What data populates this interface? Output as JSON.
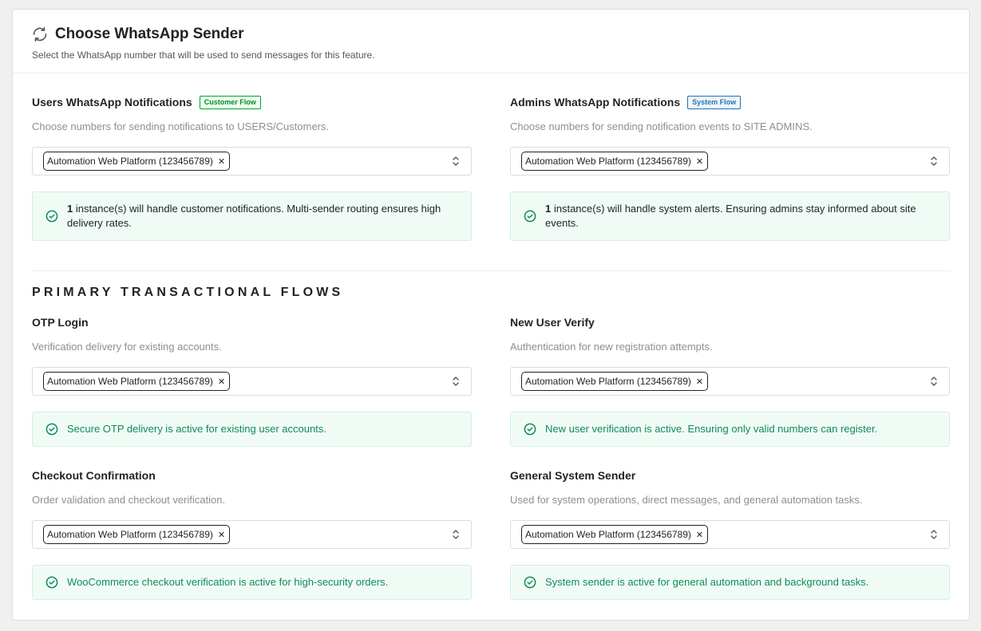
{
  "header": {
    "title": "Choose WhatsApp Sender",
    "subtitle": "Select the WhatsApp number that will be used to send messages for this feature."
  },
  "users_notifications": {
    "title": "Users WhatsApp Notifications",
    "badge": "Customer Flow",
    "description": "Choose numbers for sending notifications to USERS/Customers.",
    "selected": "Automation Web Platform (123456789)",
    "notice_count": "1",
    "notice_text": " instance(s) will handle customer notifications. Multi-sender routing ensures high delivery rates."
  },
  "admins_notifications": {
    "title": "Admins WhatsApp Notifications",
    "badge": "System Flow",
    "description": "Choose numbers for sending notification events to SITE ADMINS.",
    "selected": "Automation Web Platform (123456789)",
    "notice_count": "1",
    "notice_text": " instance(s) will handle system alerts. Ensuring admins stay informed about site events."
  },
  "section_heading": "PRIMARY TRANSACTIONAL FLOWS",
  "otp_login": {
    "title": "OTP Login",
    "description": "Verification delivery for existing accounts.",
    "selected": "Automation Web Platform (123456789)",
    "notice": "Secure OTP delivery is active for existing user accounts."
  },
  "new_user_verify": {
    "title": "New User Verify",
    "description": "Authentication for new registration attempts.",
    "selected": "Automation Web Platform (123456789)",
    "notice": "New user verification is active. Ensuring only valid numbers can register."
  },
  "checkout_confirmation": {
    "title": "Checkout Confirmation",
    "description": "Order validation and checkout verification.",
    "selected": "Automation Web Platform (123456789)",
    "notice": "WooCommerce checkout verification is active for high-security orders."
  },
  "general_system_sender": {
    "title": "General System Sender",
    "description": "Used for system operations, direct messages, and general automation tasks.",
    "selected": "Automation Web Platform (123456789)",
    "notice": "System sender is active for general automation and background tasks."
  },
  "icons": {
    "header": "refresh-icon",
    "notice": "check-circle-icon",
    "select": "chevron-up-down-icon",
    "remove": "close-icon"
  },
  "colors": {
    "notice_background": "#f1fbf6",
    "notice_green_text": "#0f8a5f",
    "customer_badge": "#00a32a",
    "system_badge": "#2271b1"
  }
}
